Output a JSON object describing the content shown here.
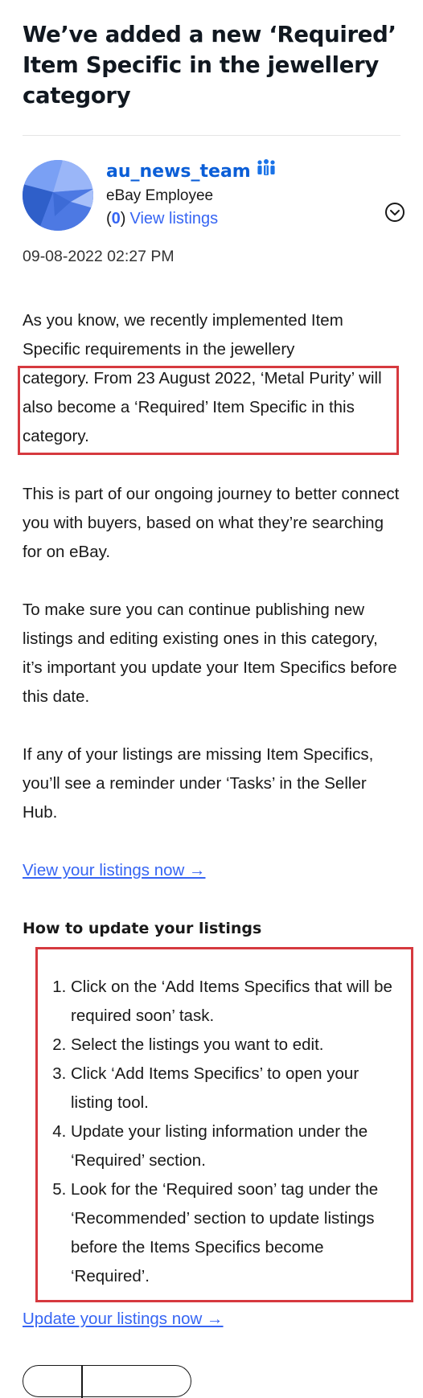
{
  "post": {
    "title": "We’ve added a new ‘Required’ Item Specific in the jewellery category"
  },
  "author": {
    "name": "au_news_team",
    "role": "eBay Employee",
    "paren_open": "(",
    "listing_count": "0",
    "paren_close": ")",
    "listings_link": "View listings",
    "badge_icon": "employee-badge-icon",
    "avatar_colors": [
      "#3d6fd8",
      "#6f96f2",
      "#9bb7f7"
    ]
  },
  "timestamp": "09-08-2022 02:27 PM",
  "body": {
    "para1_a": "As you know, we recently implemented Item Specific requirements in the jewellery",
    "para1_b": "category. From 23 August 2022, ‘Metal Purity’ will also become a ‘Required’ Item Specific in this category.",
    "para2": "This is part of our ongoing journey to better connect you with buyers, based on what they’re searching for on eBay.",
    "para3": "To make sure you can continue publishing new listings and editing existing ones in this category, it’s important you update your Item Specifics before this date.",
    "para4": "If any of your listings are missing Item Specifics, you’ll see a reminder under ‘Tasks’ in the Seller Hub.",
    "view_listings_link": "View your listings now →",
    "how_to_heading": "How to update your listings",
    "steps": [
      "Click on the ‘Add Items Specifics that will be required soon’ task.",
      "Select the listings you want to edit.",
      "Click ‘Add Items Specifics’ to open your listing tool.",
      "Update your listing information under the ‘Required’ section.",
      "Look for the ‘Required soon’ tag under the ‘Recommended’ section to update listings before the Items Specifics become ‘Required’."
    ],
    "update_listings_link": "Update your listings now →"
  },
  "colors": {
    "link": "#3665f3",
    "author_link": "#0b5ed7",
    "highlight_border": "#d6393f"
  },
  "icons": {
    "options": "chevron-down-circle-icon"
  }
}
